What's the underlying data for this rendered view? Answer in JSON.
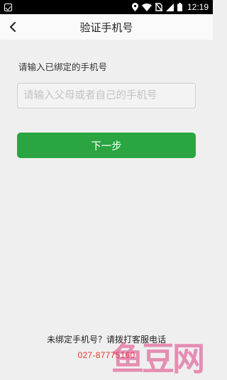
{
  "status_bar": {
    "time": "12:19",
    "icons": [
      "notification-icon",
      "location-icon",
      "wifi-icon",
      "no-sim-icon",
      "signal-icon",
      "battery-icon"
    ]
  },
  "nav": {
    "back_icon": "chevron-left-icon",
    "title": "验证手机号"
  },
  "form": {
    "prompt": "请输入已绑定的手机号",
    "phone_value": "",
    "phone_placeholder": "请输入父母或者自己的手机号",
    "next_label": "下一步"
  },
  "footer": {
    "help": "未绑定手机号？请拨打客服电话",
    "hotline": "027-87775160"
  },
  "watermark": "鱼豆网",
  "colors": {
    "accent": "#2aa542",
    "hotline": "#e03a2e",
    "background": "#efefef"
  }
}
